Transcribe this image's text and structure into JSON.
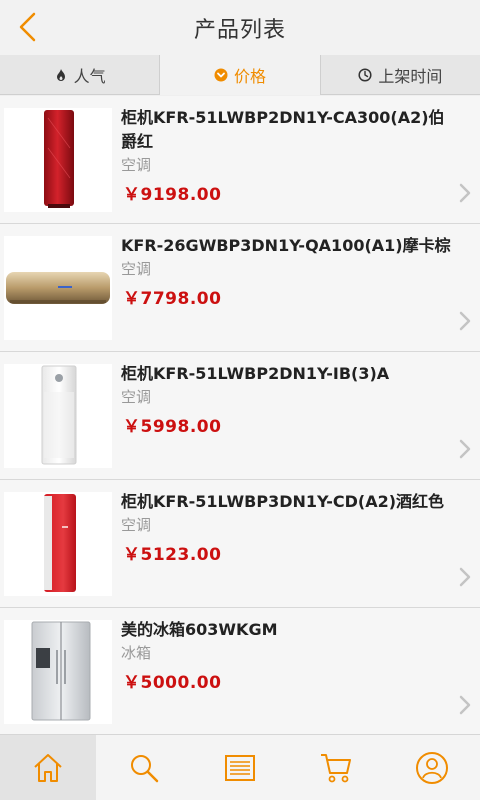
{
  "header": {
    "title": "产品列表",
    "back_icon": "chevron-left-icon"
  },
  "sort_tabs": [
    {
      "label": "人气",
      "icon": "flame-icon",
      "active": false
    },
    {
      "label": "价格",
      "icon": "chevron-down-circle-icon",
      "active": true
    },
    {
      "label": "上架时间",
      "icon": "clock-icon",
      "active": false
    }
  ],
  "products": [
    {
      "name": "柜机KFR-51LWBP2DN1Y-CA300(A2)伯爵红",
      "category": "空调",
      "price": "￥9198.00",
      "image": "red-tower-air-conditioner"
    },
    {
      "name": "KFR-26GWBP3DN1Y-QA100(A1)摩卡棕",
      "category": "空调",
      "price": "￥7798.00",
      "image": "gold-wall-air-conditioner"
    },
    {
      "name": "柜机KFR-51LWBP2DN1Y-IB(3)A",
      "category": "空调",
      "price": "￥5998.00",
      "image": "white-tower-air-conditioner"
    },
    {
      "name": "柜机KFR-51LWBP3DN1Y-CD(A2)酒红色",
      "category": "空调",
      "price": "￥5123.00",
      "image": "red-white-tower-air-conditioner"
    },
    {
      "name": "美的冰箱603WKGM",
      "category": "冰箱",
      "price": "￥5000.00",
      "image": "silver-side-by-side-refrigerator"
    }
  ],
  "bottom_tabs": [
    {
      "icon": "home-icon",
      "active": true
    },
    {
      "icon": "search-icon",
      "active": false
    },
    {
      "icon": "list-icon",
      "active": false
    },
    {
      "icon": "cart-icon",
      "active": false
    },
    {
      "icon": "user-icon",
      "active": false
    }
  ],
  "colors": {
    "accent": "#f08c00",
    "price": "#cc1010"
  }
}
